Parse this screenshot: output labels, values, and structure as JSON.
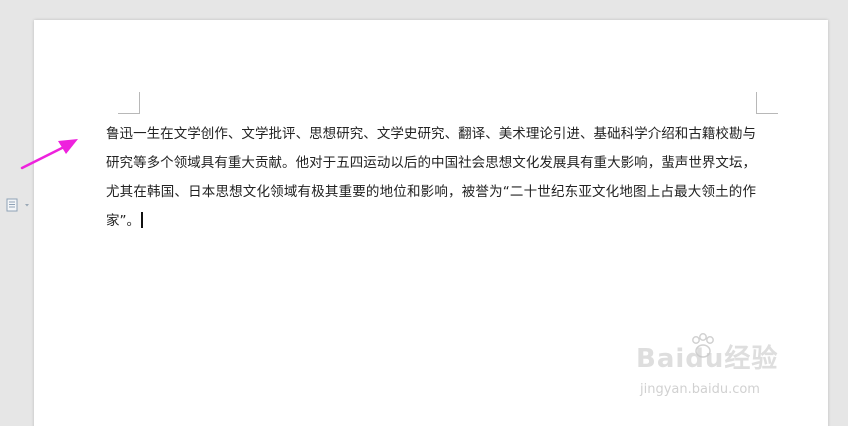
{
  "document": {
    "paragraph_text": "鲁迅一生在文学创作、文学批评、思想研究、文学史研究、翻译、美术理论引进、基础科学介绍和古籍校勘与研究等多个领域具有重大贡献。他对于五四运动以后的中国社会思想文化发展具有重大影响，蜚声世界文坛，尤其在韩国、日本思想文化领域有极其重要的地位和影响，被誉为“二十世纪东亚文化地图上占最大领土的作家”。"
  },
  "icons": {
    "paragraph_handle": "document-paragraph-icon",
    "dropdown": "chevron-down-icon",
    "annotation": "magenta-arrow"
  },
  "watermark": {
    "brand": "Baidu经验",
    "site": "jingyan.baidu.com"
  },
  "colors": {
    "page_background": "#ffffff",
    "workspace_background": "#e6e6e6",
    "arrow": "#ee22dd",
    "text": "#222222"
  }
}
